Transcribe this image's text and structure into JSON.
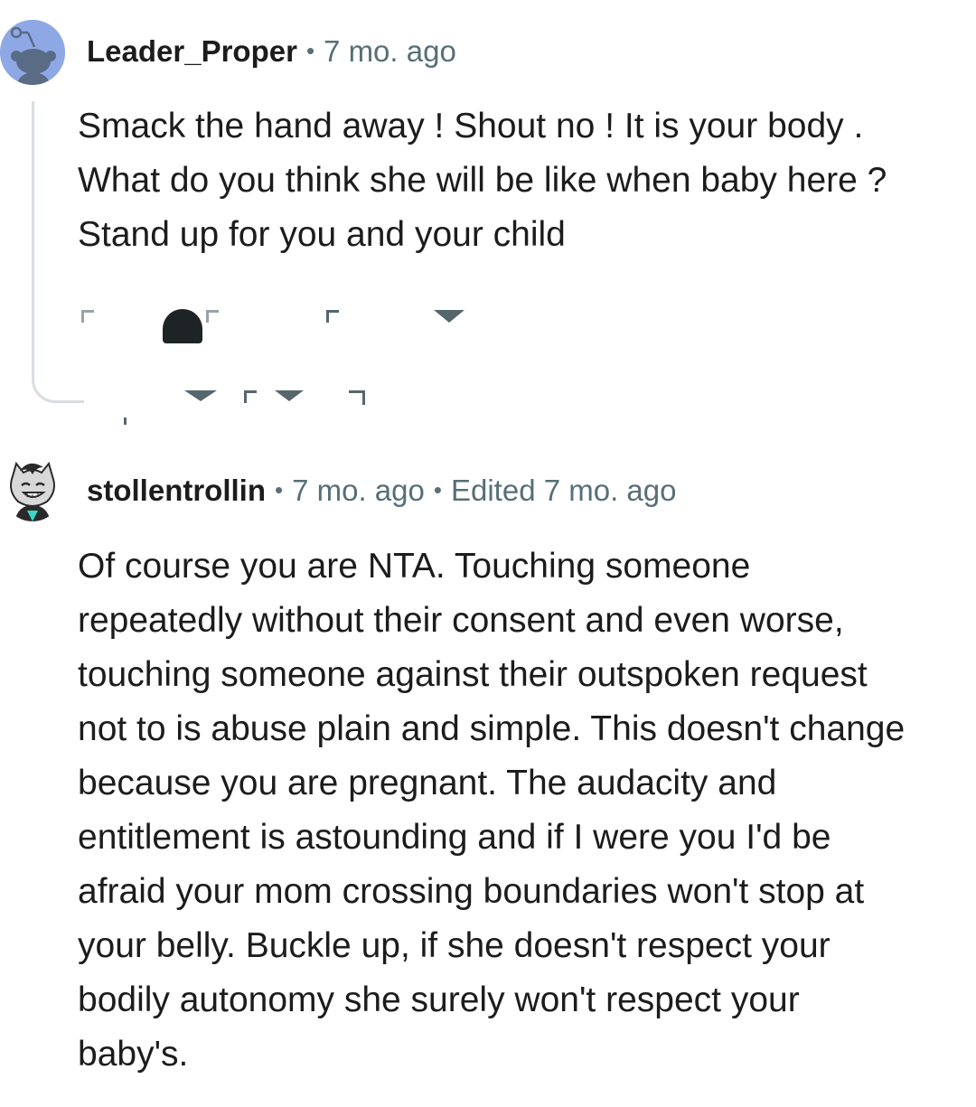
{
  "comments": [
    {
      "author": "Leader_Proper",
      "separator": "•",
      "time": "7 mo. ago",
      "avatar_icon": "reddit-snoo-avatar-icon",
      "avatar_color": "#8ea8e6",
      "body_lines": [
        "Smack the hand away ! Shout no ! It is your body .",
        "What do you think she will be like when baby here ?",
        "Stand up for you and your child"
      ]
    },
    {
      "author": "stollentrollin",
      "separator": "•",
      "time": "7 mo. ago",
      "edited": "Edited 7 mo. ago",
      "avatar_icon": "cartoon-wolf-avatar-icon",
      "body_lines": [
        "Of course you are NTA. Touching someone",
        "repeatedly without their consent and even worse,",
        "touching someone against their outspoken request",
        "not to is abuse plain and simple. This doesn't change",
        "because you are pregnant. The audacity and",
        "entitlement is astounding and if I were you I'd be",
        "afraid your mom crossing boundaries won't stop at",
        "your belly. Buckle up, if she doesn't respect your",
        "bodily autonomy she surely won't respect your",
        "baby's."
      ]
    }
  ],
  "colors": {
    "text": "#1c1c1c",
    "meta": "#576f76",
    "thread_line": "#d9dde0"
  }
}
